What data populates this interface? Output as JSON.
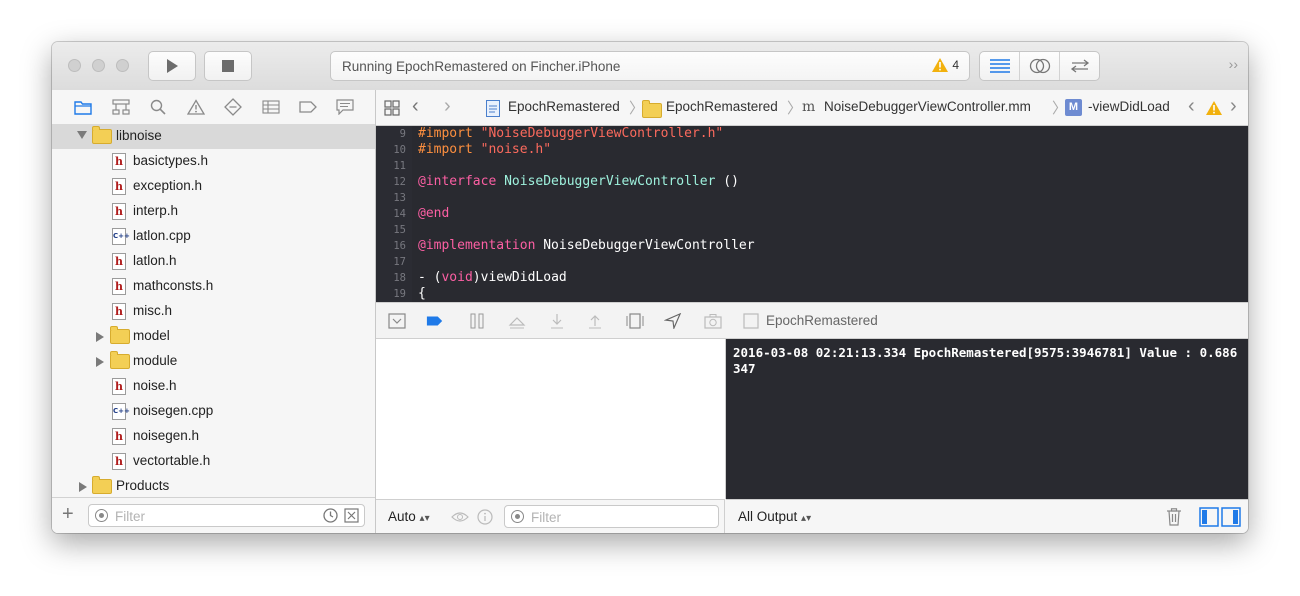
{
  "toolbar": {
    "activity_text": "Running EpochRemastered on Fincher.iPhone",
    "warning_count": "4"
  },
  "navigator": {
    "tree": [
      {
        "label": "libnoise",
        "type": "folder",
        "expanded": true,
        "indent": 0
      },
      {
        "label": "basictypes.h",
        "type": "h",
        "indent": 1
      },
      {
        "label": "exception.h",
        "type": "h",
        "indent": 1
      },
      {
        "label": "interp.h",
        "type": "h",
        "indent": 1
      },
      {
        "label": "latlon.cpp",
        "type": "cpp",
        "indent": 1
      },
      {
        "label": "latlon.h",
        "type": "h",
        "indent": 1
      },
      {
        "label": "mathconsts.h",
        "type": "h",
        "indent": 1
      },
      {
        "label": "misc.h",
        "type": "h",
        "indent": 1
      },
      {
        "label": "model",
        "type": "folder",
        "expanded": false,
        "indent": 1
      },
      {
        "label": "module",
        "type": "folder",
        "expanded": false,
        "indent": 1
      },
      {
        "label": "noise.h",
        "type": "h",
        "indent": 1
      },
      {
        "label": "noisegen.cpp",
        "type": "cpp",
        "indent": 1
      },
      {
        "label": "noisegen.h",
        "type": "h",
        "indent": 1
      },
      {
        "label": "vectortable.h",
        "type": "h",
        "indent": 1
      },
      {
        "label": "Products",
        "type": "folder",
        "expanded": false,
        "indent": 0
      }
    ],
    "filter_placeholder": "Filter"
  },
  "jumpbar": {
    "crumbs": [
      "EpochRemastered",
      "EpochRemastered",
      "NoiseDebuggerViewController.mm",
      "-viewDidLoad"
    ]
  },
  "editor": {
    "lines": [
      {
        "n": "9",
        "segments": [
          {
            "t": "#import ",
            "c": "dir"
          },
          {
            "t": "\"NoiseDebuggerViewController.h\"",
            "c": "str"
          }
        ]
      },
      {
        "n": "10",
        "segments": [
          {
            "t": "#import ",
            "c": "dir"
          },
          {
            "t": "\"noise.h\"",
            "c": "str"
          }
        ]
      },
      {
        "n": "11",
        "segments": []
      },
      {
        "n": "12",
        "segments": [
          {
            "t": "@interface ",
            "c": "kw"
          },
          {
            "t": "NoiseDebuggerViewController",
            "c": "cls"
          },
          {
            "t": " ()",
            "c": ""
          }
        ]
      },
      {
        "n": "13",
        "segments": []
      },
      {
        "n": "14",
        "segments": [
          {
            "t": "@end",
            "c": "kw"
          }
        ]
      },
      {
        "n": "15",
        "segments": []
      },
      {
        "n": "16",
        "segments": [
          {
            "t": "@implementation ",
            "c": "kw"
          },
          {
            "t": "NoiseDebuggerViewController",
            "c": ""
          }
        ]
      },
      {
        "n": "17",
        "segments": []
      },
      {
        "n": "18",
        "segments": [
          {
            "t": "- (",
            "c": ""
          },
          {
            "t": "void",
            "c": "kw"
          },
          {
            "t": ")viewDidLoad",
            "c": ""
          }
        ]
      },
      {
        "n": "19",
        "segments": [
          {
            "t": "{",
            "c": ""
          }
        ]
      }
    ]
  },
  "debugbar": {
    "target_label": "EpochRemastered"
  },
  "variables": {
    "scope_select": "Auto",
    "filter_placeholder": "Filter"
  },
  "console": {
    "output": "2016-03-08 02:21:13.334 EpochRemastered[9575:3946781] Value : 0.686347",
    "output_select": "All Output"
  }
}
